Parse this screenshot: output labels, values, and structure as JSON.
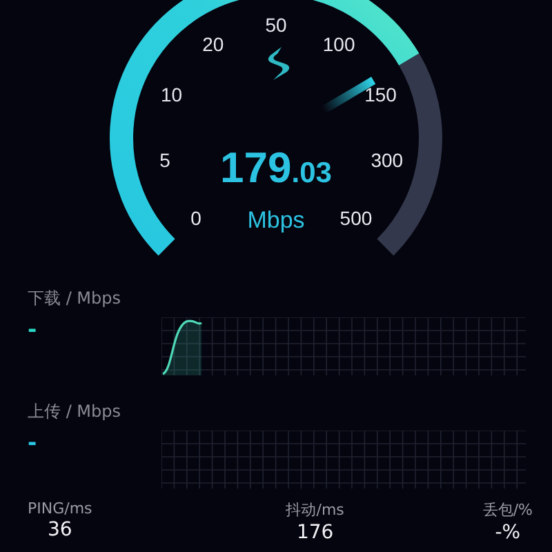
{
  "gauge": {
    "scale": [
      "0",
      "5",
      "10",
      "20",
      "50",
      "100",
      "150",
      "300",
      "500"
    ],
    "value_main": "179",
    "value_fraction": ".03",
    "unit": "Mbps"
  },
  "download": {
    "label": "下载 / Mbps",
    "value": "-"
  },
  "upload": {
    "label": "上传 / Mbps",
    "value": "-"
  },
  "stats": [
    {
      "label": "PING/ms",
      "value": "36"
    },
    {
      "label": "抖动/ms",
      "value": "176"
    },
    {
      "label": "丢包/%",
      "value": "-%"
    }
  ]
}
